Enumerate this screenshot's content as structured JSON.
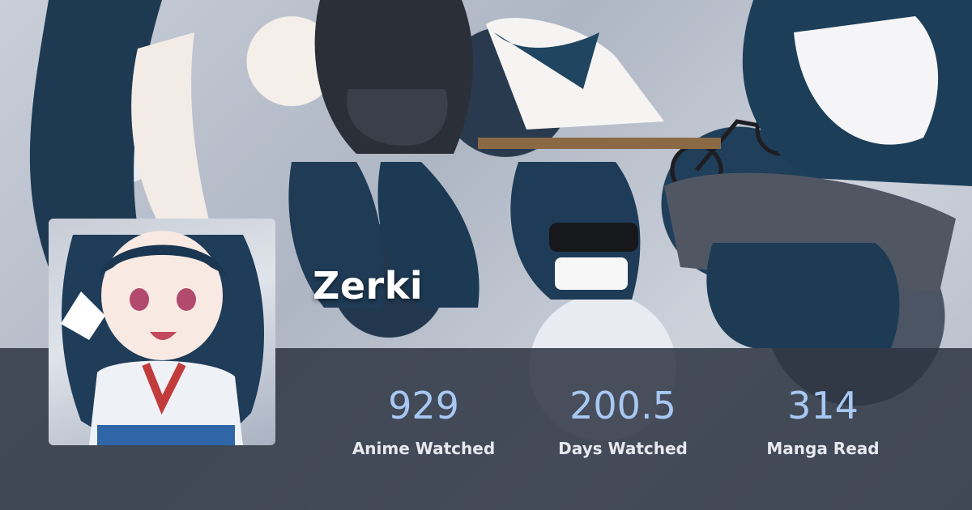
{
  "profile": {
    "username": "Zerki"
  },
  "stats": [
    {
      "value": "929",
      "label": "Anime Watched"
    },
    {
      "value": "200.5",
      "label": "Days Watched"
    },
    {
      "value": "314",
      "label": "Manga Read"
    }
  ],
  "colors": {
    "stat_value": "#a7c8f2",
    "stat_label": "#e6e9ef",
    "stats_bar": "#2d3442",
    "username": "#ffffff"
  }
}
